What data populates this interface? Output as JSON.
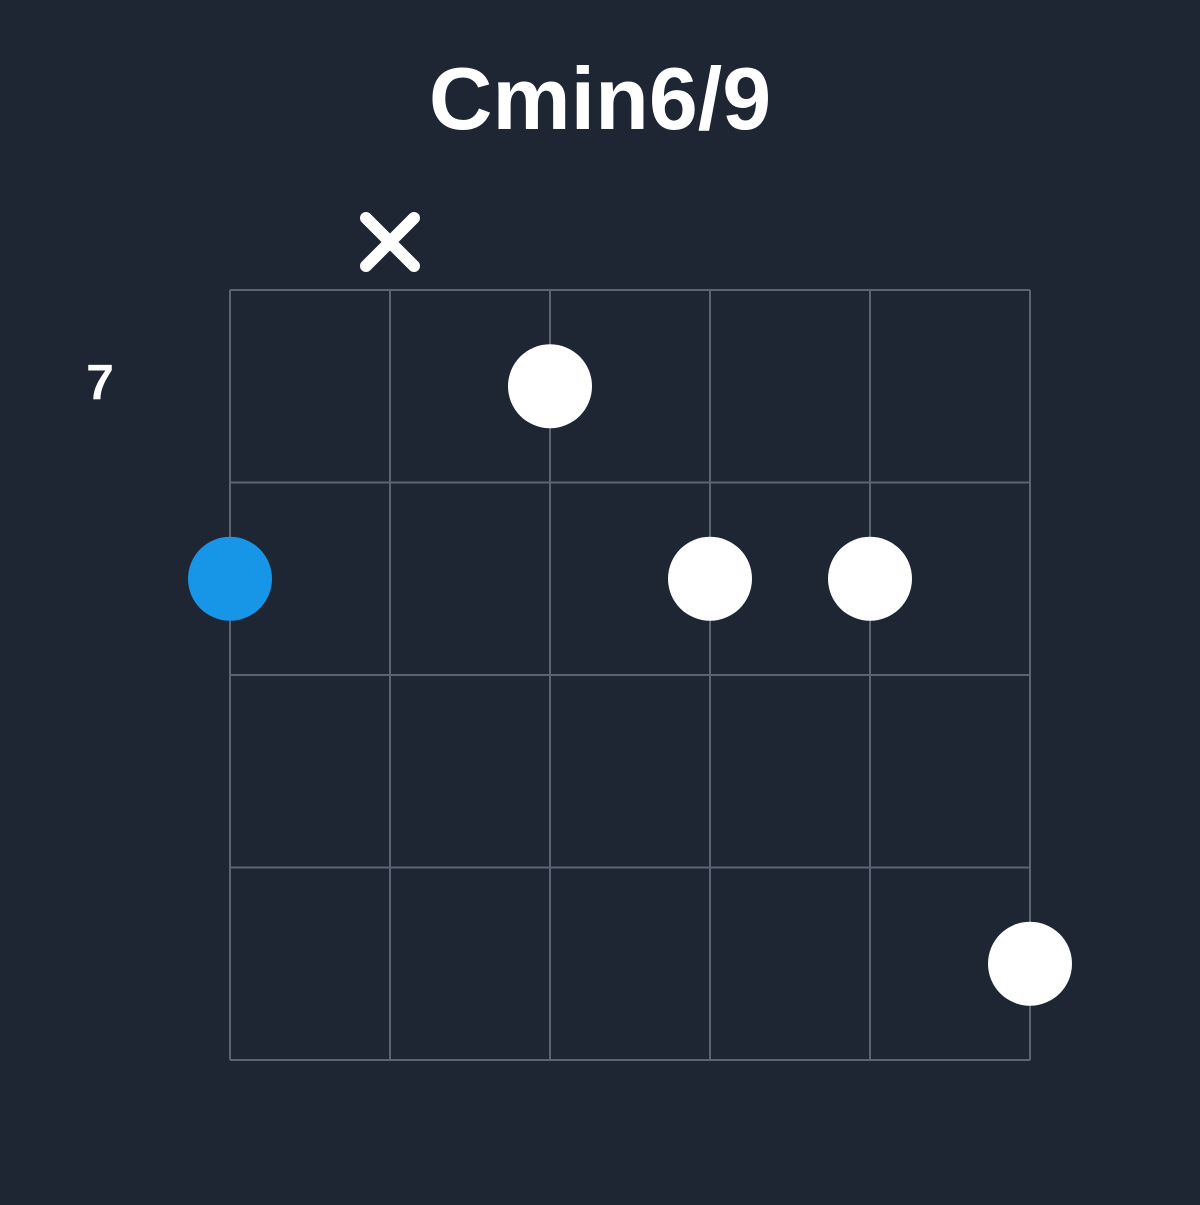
{
  "chord": {
    "name": "Cmin6/9",
    "startFret": 7,
    "numFrets": 4,
    "numStrings": 6,
    "strings": [
      {
        "string": 1,
        "status": "fretted",
        "fret": 2,
        "root": true
      },
      {
        "string": 2,
        "status": "muted"
      },
      {
        "string": 3,
        "status": "fretted",
        "fret": 1,
        "root": false
      },
      {
        "string": 4,
        "status": "fretted",
        "fret": 2,
        "root": false
      },
      {
        "string": 5,
        "status": "fretted",
        "fret": 2,
        "root": false
      },
      {
        "string": 6,
        "status": "fretted",
        "fret": 4,
        "root": false
      }
    ]
  },
  "layout": {
    "gridLeft": 230,
    "gridTop": 290,
    "gridWidth": 800,
    "gridHeight": 770,
    "dotRadius": 42,
    "markerFontSize": 56,
    "fretLabelFontSize": 50
  },
  "colors": {
    "background": "#1e2533",
    "grid": "#5c6373",
    "dot": "#ffffff",
    "rootDot": "#1795e6",
    "text": "#ffffff",
    "marker": "#ffffff"
  }
}
